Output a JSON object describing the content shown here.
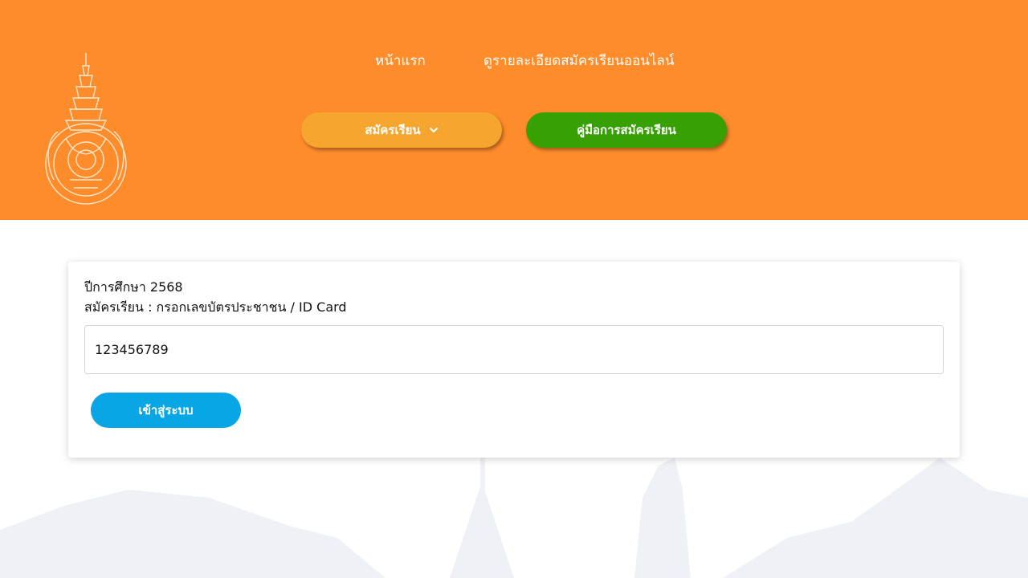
{
  "header": {
    "nav": {
      "home": "หน้าแรก",
      "detail": "ดูรายละเอียดสมัครเรียนออนไลน์"
    },
    "buttons": {
      "register": "สมัครเรียน",
      "register_icon": "chevron-down-icon",
      "manual": "คู่มือการสมัครเรียน"
    },
    "colors": {
      "header_bg": "#ff8c2b",
      "register_bg": "#f6a52f",
      "manual_bg": "#37a003"
    }
  },
  "form": {
    "year_label": "ปีการศึกษา 2568",
    "prompt": "สมัครเรียน : กรอกเลขบัตรประชาชน / ID Card",
    "id_value": "123456789",
    "login_label": "เข้าสู่ระบบ",
    "login_color": "#08a6e4"
  }
}
